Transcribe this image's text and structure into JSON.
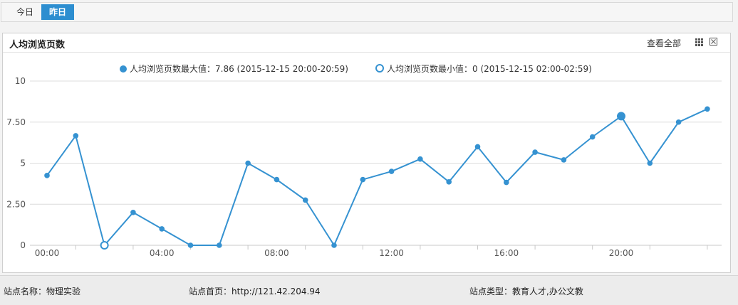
{
  "tabs": {
    "today": "今日",
    "yesterday": "昨日",
    "active": "yesterday"
  },
  "panel": {
    "title": "人均浏览页数",
    "view_all": "查看全部",
    "grid_icon": "grid-icon",
    "close_icon": "close-box-icon"
  },
  "legend": {
    "max": "人均浏览页数最大值：7.86 (2015-12-15 20:00-20:59)",
    "min": "人均浏览页数最小值：0 (2015-12-15 02:00-02:59)"
  },
  "footer": {
    "name_label": "站点名称：",
    "name_value": "物理实验",
    "home_label": "站点首页：",
    "home_value": "http://121.42.204.94",
    "type_label": "站点类型：",
    "type_value": "教育人才,办公文教"
  },
  "colors": {
    "line": "#3592d1",
    "tab_active": "#2d8ed0",
    "grid": "#dcdcdc"
  },
  "chart_data": {
    "type": "line",
    "title": "",
    "xlabel": "",
    "ylabel": "",
    "ylim": [
      0,
      10
    ],
    "yticks": [
      "10",
      "7.50",
      "5",
      "2.50",
      "0"
    ],
    "ytick_values": [
      10,
      7.5,
      5,
      2.5,
      0
    ],
    "xticks": [
      "00:00",
      "04:00",
      "08:00",
      "12:00",
      "16:00",
      "20:00"
    ],
    "xtick_hours": [
      0,
      4,
      8,
      12,
      16,
      20
    ],
    "grid": true,
    "series": [
      {
        "name": "人均浏览页数",
        "x": [
          0,
          1,
          2,
          3,
          4,
          5,
          6,
          7,
          8,
          9,
          10,
          11,
          12,
          13,
          14,
          15,
          16,
          17,
          18,
          19,
          20,
          21,
          22,
          23
        ],
        "values": [
          4.25,
          6.67,
          0,
          2,
          1,
          0,
          0,
          5,
          4,
          2.75,
          0,
          4,
          4.5,
          5.25,
          3.86,
          6,
          3.83,
          5.67,
          5.2,
          6.6,
          7.86,
          5,
          7.5,
          8.3
        ],
        "max_index": 20,
        "min_index": 2
      }
    ]
  }
}
